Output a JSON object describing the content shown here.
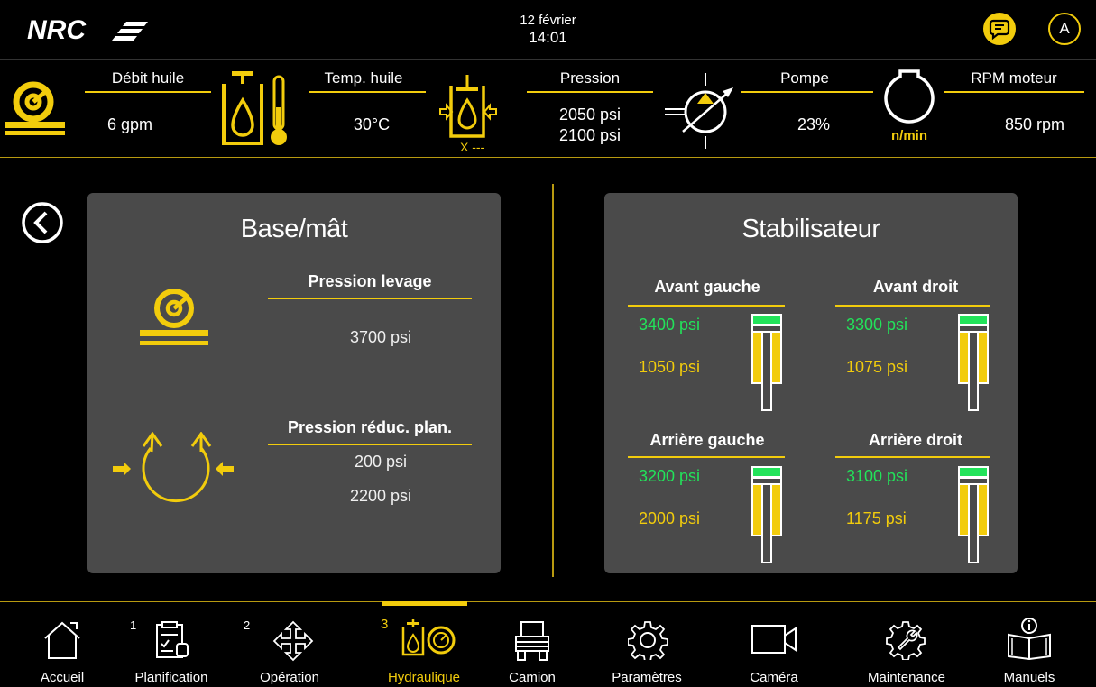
{
  "header": {
    "logo_text": "NRC",
    "date": "12 février",
    "time": "14:01",
    "user_initial": "A"
  },
  "metrics": [
    {
      "label": "Débit huile",
      "values": [
        "6 gpm"
      ],
      "icon": "flow-meter-icon"
    },
    {
      "label": "Temp. huile",
      "values": [
        "30°C"
      ],
      "icon": "oil-temperature-icon"
    },
    {
      "label": "Pression",
      "values": [
        "2050 psi",
        "2100 psi"
      ],
      "icon": "pressure-cylinder-icon",
      "sub": "X ---"
    },
    {
      "label": "Pompe",
      "values": [
        "23%"
      ],
      "icon": "variable-pump-icon"
    },
    {
      "label": "RPM moteur",
      "values": [
        "850 rpm"
      ],
      "icon": "engine-rpm-icon",
      "icon_text": "n/min"
    }
  ],
  "base_panel": {
    "title": "Base/mât",
    "lift": {
      "label": "Pression levage",
      "values": [
        "3700 psi"
      ]
    },
    "planetary": {
      "label": "Pression réduc. plan.",
      "values": [
        "200 psi",
        "2200 psi"
      ]
    }
  },
  "stabilizer_panel": {
    "title": "Stabilisateur",
    "legs": [
      {
        "label": "Avant gauche",
        "top": "3400 psi",
        "bottom": "1050 psi"
      },
      {
        "label": "Avant droit",
        "top": "3300 psi",
        "bottom": "1075 psi"
      },
      {
        "label": "Arrière gauche",
        "top": "3200 psi",
        "bottom": "2000 psi"
      },
      {
        "label": "Arrière droit",
        "top": "3100 psi",
        "bottom": "1175 psi"
      }
    ]
  },
  "nav": [
    {
      "label": "Accueil",
      "num": "",
      "icon": "home-icon"
    },
    {
      "label": "Planification",
      "num": "1",
      "icon": "clipboard-icon"
    },
    {
      "label": "Opération",
      "num": "2",
      "icon": "move-arrows-icon"
    },
    {
      "label": "Hydraulique",
      "num": "3",
      "icon": "hydraulic-icon",
      "active": true
    },
    {
      "label": "Camion",
      "num": "",
      "icon": "truck-icon"
    },
    {
      "label": "Paramètres",
      "num": "",
      "icon": "gear-icon"
    },
    {
      "label": "Caméra",
      "num": "",
      "icon": "camera-icon"
    },
    {
      "label": "Maintenance",
      "num": "",
      "icon": "wrench-gear-icon"
    },
    {
      "label": "Manuels",
      "num": "",
      "icon": "manual-book-icon"
    }
  ],
  "colors": {
    "accent": "#f2cc0c",
    "green": "#22e35a",
    "panel": "#4a4a4a"
  }
}
